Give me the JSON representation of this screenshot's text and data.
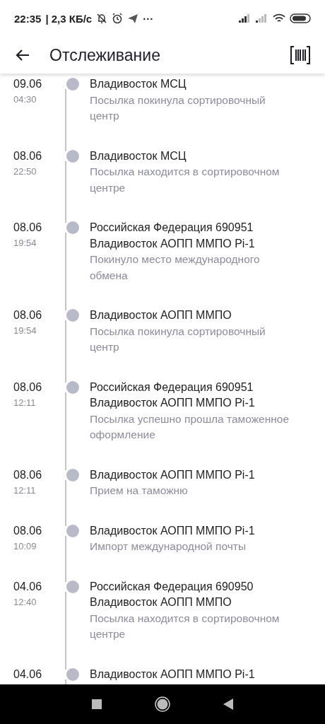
{
  "status_bar": {
    "time": "22:35",
    "speed": "| 2,3 КБ/с",
    "more": "···"
  },
  "header": {
    "title": "Отслеживание"
  },
  "events": [
    {
      "date": "09.06",
      "time": "04:30",
      "place": "Владивосток МСЦ",
      "description": "Посылка покинула сортировочный\nцентр"
    },
    {
      "date": "08.06",
      "time": "22:50",
      "place": "Владивосток МСЦ",
      "description": "Посылка находится в сортировочном\nцентре"
    },
    {
      "date": "08.06",
      "time": "19:54",
      "place": "Российская Федерация 690951\nВладивосток АОПП ММПО Pi-1",
      "description": "Покинуло место международного\nобмена"
    },
    {
      "date": "08.06",
      "time": "19:54",
      "place": "Владивосток АОПП ММПО",
      "description": "Посылка покинула сортировочный\nцентр"
    },
    {
      "date": "08.06",
      "time": "12:11",
      "place": "Российская Федерация 690951\nВладивосток АОПП ММПО Pi-1",
      "description": "Посылка успешно прошла таможенное\nоформление"
    },
    {
      "date": "08.06",
      "time": "12:11",
      "place": "Владивосток АОПП ММПО Pi-1",
      "description": "Прием на таможню"
    },
    {
      "date": "08.06",
      "time": "10:09",
      "place": "Владивосток АОПП ММПО Pi-1",
      "description": "Импорт международной почты"
    },
    {
      "date": "04.06",
      "time": "12:40",
      "place": "Российская Федерация 690950\nВладивосток АОПП ММПО",
      "description": "Посылка находится в сортировочном\nцентре"
    },
    {
      "date": "04.06",
      "place": "Владивосток АОПП ММПО Pi-1"
    }
  ]
}
